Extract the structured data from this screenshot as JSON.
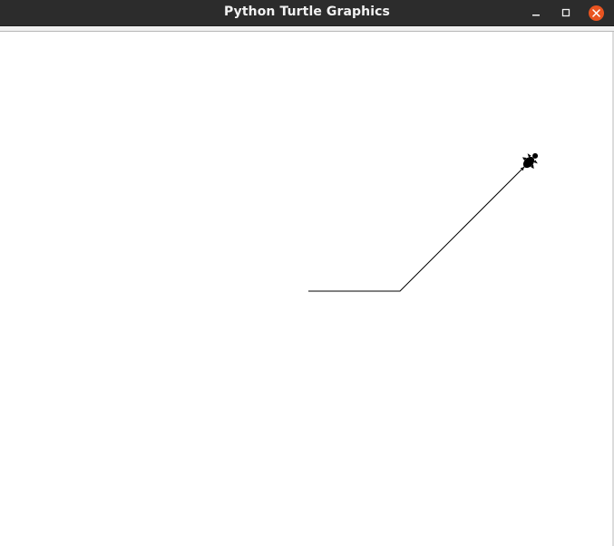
{
  "window": {
    "title": "Python Turtle Graphics",
    "titlebar_color": "#2c2c2c",
    "title_color": "#f2f2f2",
    "close_button_color": "#e95420"
  },
  "controls": {
    "minimize_icon": "minimize-icon",
    "maximize_icon": "maximize-icon",
    "close_icon": "close-icon"
  },
  "canvas": {
    "background": "#ffffff",
    "pen_color": "#000000",
    "turtle_icon": "turtle-icon",
    "turtle_color": "#000000"
  }
}
